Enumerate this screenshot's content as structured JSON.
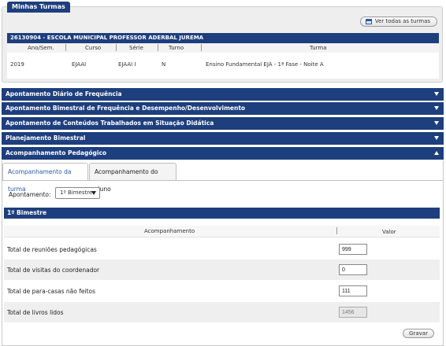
{
  "turmas": {
    "title": "Minhas Turmas",
    "ver_todas": "Ver todas as turmas",
    "school": "26130904 - ESCOLA MUNICIPAL PROFESSOR ADERBAL JUREMA",
    "headers": {
      "ano": "Ano/Sem.",
      "curso": "Curso",
      "serie": "Série",
      "turno": "Turno",
      "turma": "Turma"
    },
    "row": {
      "ano": "2019",
      "curso": "EJAAI",
      "serie": "EJAAI I",
      "turno": "N",
      "turma": "Ensino Fundamental EJA - 1ª Fase - Noite A"
    }
  },
  "accordion": [
    {
      "label": "Apontamento Diário de Frequência",
      "expanded": false
    },
    {
      "label": "Apontamento Bimestral de Frequência e Desempenho/Desenvolvimento",
      "expanded": false
    },
    {
      "label": "Apontamento de Conteúdos Trabalhados em Situação Didática",
      "expanded": false
    },
    {
      "label": "Planejamento Bimestral",
      "expanded": false
    },
    {
      "label": "Acompanhamento Pedagógico",
      "expanded": true
    }
  ],
  "tabs": {
    "turma": "Acompanhamento da turma",
    "aluno": "Acompanhamento do aluno",
    "active": "turma"
  },
  "apontamento": {
    "label": "Apontamento:",
    "selected": "1º Bimestre"
  },
  "bimestre": {
    "title": "1º Bimestre",
    "col_acompanhamento": "Acompanhamento",
    "col_valor": "Valor",
    "rows": [
      {
        "label": "Total de reuniões pedagógicas",
        "value": "999",
        "readonly": false
      },
      {
        "label": "Total de visitas do coordenador",
        "value": "0",
        "readonly": false
      },
      {
        "label": "Total de para-casas não feitos",
        "value": "111",
        "readonly": false
      },
      {
        "label": "Total de livros lidos",
        "value": "1456",
        "readonly": true
      }
    ]
  },
  "gravar": "Gravar",
  "colors": {
    "primary": "#1e3f7e",
    "tab_active_text": "#2a5aa8"
  }
}
